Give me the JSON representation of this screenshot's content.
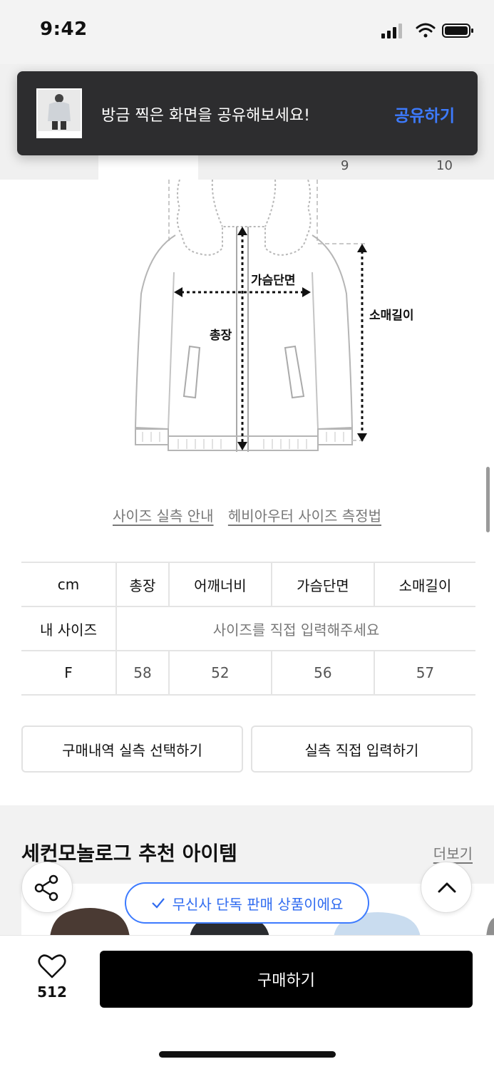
{
  "status_bar": {
    "time": "9:42"
  },
  "tabs": {
    "numbers": [
      "9",
      "10"
    ]
  },
  "toast": {
    "message": "방금 찍은 화면을 공유해보세요!",
    "action": "공유하기"
  },
  "diagram": {
    "labels": {
      "chest": "가슴단면",
      "length": "총장",
      "sleeve": "소매길이"
    }
  },
  "guide_links": [
    "사이즈 실측 안내",
    "헤비아우터 사이즈 측정법"
  ],
  "size_table": {
    "unit": "cm",
    "columns": [
      "총장",
      "어깨너비",
      "가슴단면",
      "소매길이"
    ],
    "my_size_label": "내 사이즈",
    "my_size_placeholder": "사이즈를 직접 입력해주세요",
    "rows": [
      {
        "size": "F",
        "values": [
          "58",
          "52",
          "56",
          "57"
        ]
      }
    ]
  },
  "buttons": {
    "select_purchase": "구매내역 실측 선택하기",
    "direct_input": "실측 직접 입력하기"
  },
  "recommend": {
    "title": "세컨모놀로그 추천 아이템",
    "more": "더보기"
  },
  "exclusive_badge": "무신사 단독 판매 상품이에요",
  "bottom": {
    "like_count": "512",
    "buy_label": "구매하기"
  },
  "colors": {
    "accent_blue": "#3d7bff",
    "toast_bg": "#2d2d2f",
    "buy_bg": "#000000"
  }
}
